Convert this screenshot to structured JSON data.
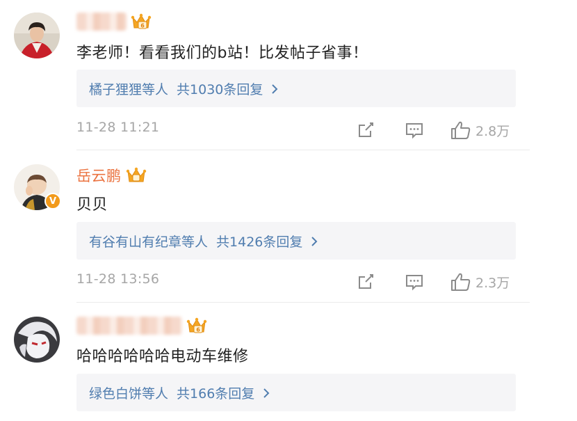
{
  "comments": [
    {
      "name": "",
      "name_blurred": true,
      "text": "李老师！看看我们的b站！比发帖子省事！",
      "reply_who": "橘子狸狸等人",
      "reply_total": "共1030条回复",
      "time": "11-28 11:21",
      "likes": "2.8万",
      "verified": false
    },
    {
      "name": "岳云鹏",
      "name_blurred": false,
      "text": "贝贝",
      "reply_who": "有谷有山有纪章等人",
      "reply_total": "共1426条回复",
      "time": "11-28 13:56",
      "likes": "2.3万",
      "verified": true,
      "verified_badge": "V"
    },
    {
      "name": "",
      "name_blurred": true,
      "text": "哈哈哈哈哈哈电动车维修",
      "reply_who": "绿色白饼等人",
      "reply_total": "共166条回复",
      "verified": false
    }
  ],
  "icons": {
    "share": "share-icon",
    "comment": "comment-icon",
    "like": "thumbs-up-icon",
    "crown": "vip-crown-icon",
    "chevron": "chevron-right-icon"
  },
  "colors": {
    "name": "#eb7340",
    "link": "#507daf",
    "muted": "#a6a6a6",
    "reply_bg": "#f5f5f7",
    "crown": "#f5a623"
  }
}
